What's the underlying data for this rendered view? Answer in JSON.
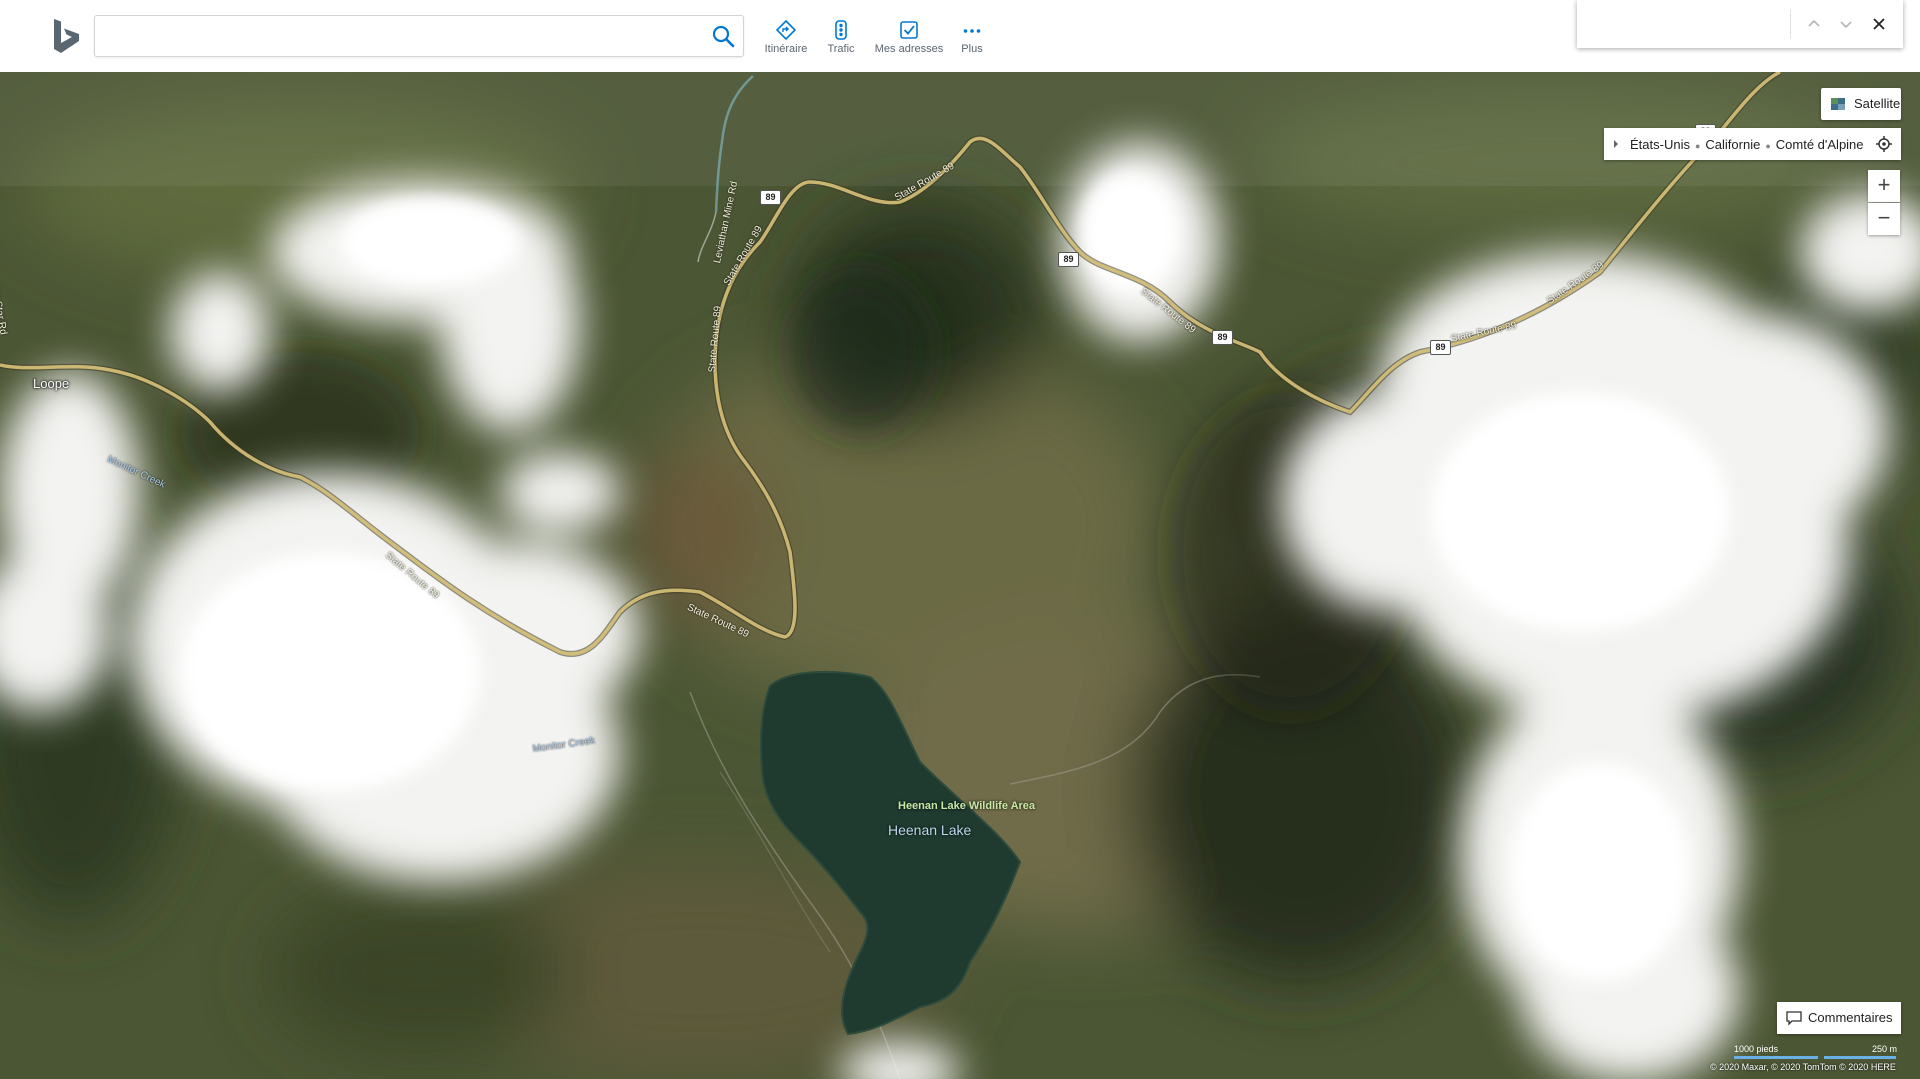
{
  "search": {
    "value": "",
    "placeholder": ""
  },
  "nav": [
    {
      "label": "Itinéraire",
      "icon": "directions-icon"
    },
    {
      "label": "Trafic",
      "icon": "traffic-light-icon"
    },
    {
      "label": "Mes adresses",
      "icon": "my-places-icon"
    },
    {
      "label": "Plus",
      "icon": "more-dots-icon"
    }
  ],
  "find_panel": {
    "value": ""
  },
  "map_controls": {
    "satellite_label": "Satellite",
    "breadcrumb": [
      "États-Unis",
      "Californie",
      "Comté d'Alpine"
    ],
    "zoom_in": "+",
    "zoom_out": "−",
    "feedback_label": "Commentaires"
  },
  "scale": {
    "imperial": "1000 pieds",
    "metric": "250 m"
  },
  "copyright": "© 2020 Maxar, © 2020 TomTom © 2020 HERE",
  "map_labels": {
    "place_loope": "Loope",
    "lake": "Heenan Lake",
    "wildlife_area": "Heenan Lake Wildlife Area",
    "monitor_creek_1": "Monitor Creek",
    "monitor_creek_2": "Monitor Creek",
    "state_route_1": "State Route 89",
    "state_route_2": "State Route 89",
    "state_route_3": "State Route 89",
    "state_route_4": "State Route 89",
    "state_route_5": "State Route 89",
    "state_route_6": "State Route 89",
    "state_route_7": "State Route 89",
    "state_route_8": "State Route 89",
    "morning_star": "Morning Star Rd",
    "leviathan": "Leviathan Mine Rd"
  },
  "route_shield": "89",
  "colors": {
    "accent": "#0078d4",
    "route": "#d8c37a",
    "terrain": "#4a5532",
    "lake": "#1f3b30",
    "cloud": "#f4f4f2"
  }
}
